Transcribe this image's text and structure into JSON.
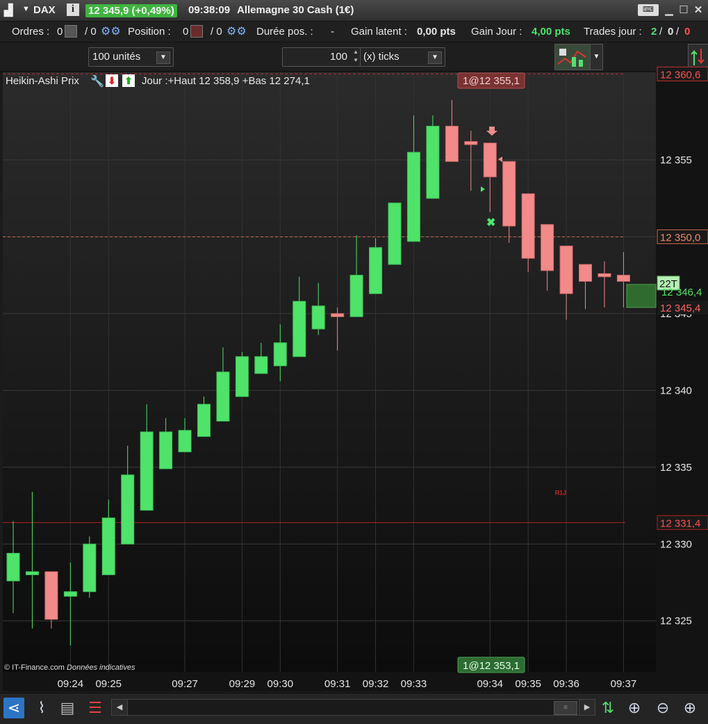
{
  "titlebar": {
    "symbol": "DAX",
    "info_icon": "info-icon",
    "price_change": "12 345,9 (+0,49%)",
    "time": "09:38:09",
    "instrument": "Allemagne 30 Cash (1€)"
  },
  "status": {
    "orders_label": "Ordres :",
    "orders_a": "0",
    "orders_b": "/ 0",
    "position_label": "Position :",
    "position_a": "0",
    "position_b": "/ 0",
    "duration_label": "Durée pos. :",
    "duration_value": "-",
    "latent_label": "Gain latent :",
    "latent_value": "0,00 pts",
    "gain_label": "Gain Jour :",
    "gain_value": "4,00 pts",
    "trades_label": "Trades jour :",
    "trades_a": "2",
    "trades_sep1": "/",
    "trades_b": "0",
    "trades_sep2": "/",
    "trades_c": "0"
  },
  "toolbar": {
    "units": "100 unités",
    "ticks_value": "100",
    "ticks_unit": "(x) ticks"
  },
  "indicator": {
    "name": "Heikin-Ashi Prix",
    "day_info": "Jour :+Haut 12 358,9 +Bas 12 274,1"
  },
  "colors": {
    "bull": "#4fe36a",
    "bear": "#f28a8a",
    "bear_dark": "#e06c6c",
    "red_level": "#c73030"
  },
  "chart_data": {
    "type": "candlestick",
    "style": "Heikin-Ashi",
    "ylim": [
      12321,
      12362
    ],
    "yticks": [
      12325,
      12330,
      12335,
      12340,
      12345,
      12350,
      12355
    ],
    "ytick_labels": [
      "12 325",
      "12 330",
      "12 335",
      "12 340",
      "12 345",
      "12 350",
      "12 355"
    ],
    "xtick_labels": [
      {
        "label": "09:24",
        "candle": 3
      },
      {
        "label": "09:25",
        "candle": 5
      },
      {
        "label": "09:27",
        "candle": 9
      },
      {
        "label": "09:29",
        "candle": 12
      },
      {
        "label": "09:30",
        "candle": 14
      },
      {
        "label": "09:31",
        "candle": 17
      },
      {
        "label": "09:32",
        "candle": 19
      },
      {
        "label": "09:33",
        "candle": 21
      },
      {
        "label": "09:34",
        "candle": 25
      },
      {
        "label": "09:35",
        "candle": 27
      },
      {
        "label": "09:36",
        "candle": 29
      },
      {
        "label": "09:37",
        "candle": 32
      }
    ],
    "candles": [
      {
        "o": 12327.6,
        "c": 12329.4,
        "h": 12331.5,
        "l": 12325.5
      },
      {
        "o": 12328.0,
        "c": 12328.2,
        "h": 12333.4,
        "l": 12324.5
      },
      {
        "o": 12328.2,
        "c": 12325.1,
        "h": 12326.0,
        "l": 12324.5
      },
      {
        "o": 12326.6,
        "c": 12326.9,
        "h": 12328.8,
        "l": 12323.4
      },
      {
        "o": 12326.9,
        "c": 12330.0,
        "h": 12330.5,
        "l": 12326.5
      },
      {
        "o": 12328.0,
        "c": 12331.7,
        "h": 12332.9,
        "l": 12328.0
      },
      {
        "o": 12330.0,
        "c": 12334.5,
        "h": 12336.4,
        "l": 12330.0
      },
      {
        "o": 12332.2,
        "c": 12337.3,
        "h": 12339.1,
        "l": 12332.2
      },
      {
        "o": 12334.9,
        "c": 12337.3,
        "h": 12338.2,
        "l": 12334.9
      },
      {
        "o": 12336.0,
        "c": 12337.4,
        "h": 12338.2,
        "l": 12336.0
      },
      {
        "o": 12337.0,
        "c": 12339.1,
        "h": 12339.6,
        "l": 12337.0
      },
      {
        "o": 12338.0,
        "c": 12341.2,
        "h": 12342.8,
        "l": 12338.0
      },
      {
        "o": 12339.6,
        "c": 12342.2,
        "h": 12342.5,
        "l": 12339.6
      },
      {
        "o": 12341.1,
        "c": 12342.2,
        "h": 12343.1,
        "l": 12341.1
      },
      {
        "o": 12341.6,
        "c": 12343.1,
        "h": 12344.3,
        "l": 12340.6
      },
      {
        "o": 12342.2,
        "c": 12345.8,
        "h": 12347.4,
        "l": 12342.2
      },
      {
        "o": 12344.0,
        "c": 12345.5,
        "h": 12347.0,
        "l": 12343.6
      },
      {
        "o": 12345.0,
        "c": 12344.8,
        "h": 12345.4,
        "l": 12342.6
      },
      {
        "o": 12344.8,
        "c": 12347.5,
        "h": 12350.1,
        "l": 12344.8
      },
      {
        "o": 12346.3,
        "c": 12349.3,
        "h": 12349.9,
        "l": 12346.3
      },
      {
        "o": 12348.2,
        "c": 12352.2,
        "h": 12352.2,
        "l": 12348.2
      },
      {
        "o": 12349.7,
        "c": 12355.5,
        "h": 12357.9,
        "l": 12349.7
      },
      {
        "o": 12352.5,
        "c": 12357.2,
        "h": 12357.9,
        "l": 12352.5
      },
      {
        "o": 12357.2,
        "c": 12354.9,
        "h": 12358.9,
        "l": 12354.9
      },
      {
        "o": 12356.2,
        "c": 12356.0,
        "h": 12356.9,
        "l": 12353.0
      },
      {
        "o": 12356.1,
        "c": 12353.9,
        "h": 12356.1,
        "l": 12351.6
      },
      {
        "o": 12354.9,
        "c": 12350.7,
        "h": 12354.9,
        "l": 12349.6
      },
      {
        "o": 12352.8,
        "c": 12348.6,
        "h": 12352.8,
        "l": 12347.7
      },
      {
        "o": 12350.8,
        "c": 12347.8,
        "h": 12350.8,
        "l": 12346.5
      },
      {
        "o": 12349.4,
        "c": 12346.3,
        "h": 12349.4,
        "l": 12344.6
      },
      {
        "o": 12348.2,
        "c": 12347.1,
        "h": 12348.2,
        "l": 12345.3
      },
      {
        "o": 12347.6,
        "c": 12347.4,
        "h": 12348.4,
        "l": 12345.4
      },
      {
        "o": 12347.5,
        "c": 12347.1,
        "h": 12349.0,
        "l": 12345.4
      }
    ],
    "levels": [
      {
        "price": 12360.6,
        "label": "12 360,6",
        "color": "#c73030",
        "style": "dashed"
      },
      {
        "price": 12350.0,
        "label": "12 350,0",
        "color": "#c8674a",
        "style": "dashed"
      },
      {
        "price": 12331.4,
        "label": "12 331,4",
        "color": "#b32020",
        "style": "solid"
      }
    ],
    "current_price": {
      "label": "12 346,4",
      "price": 12346.4
    },
    "bid_price": {
      "label": "12 345,4",
      "price": 12345.4
    },
    "tick_counter": "22T",
    "order_top": "1@12 355,1",
    "order_bottom": "1@12 353,1",
    "annotation": {
      "text": "R1J",
      "price": 12333.2,
      "candle": 28.4
    },
    "copyright": "© IT-Finance.com",
    "disclaimer": "Données indicatives"
  }
}
